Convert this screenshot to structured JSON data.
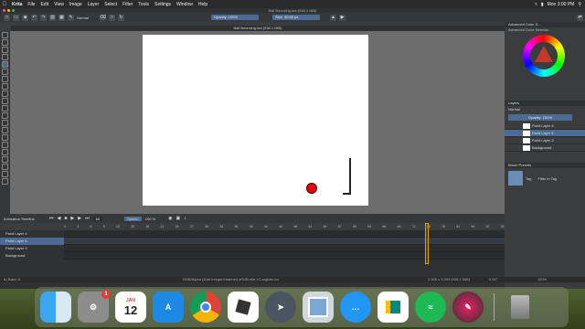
{
  "menubar": {
    "app": "Krita",
    "items": [
      "File",
      "Edit",
      "View",
      "Image",
      "Layer",
      "Select",
      "Filter",
      "Tools",
      "Settings",
      "Window",
      "Help"
    ],
    "clock": "Mon 3:00 PM"
  },
  "window": {
    "title": "Ball Bouncing.kra (938.1 MiB)"
  },
  "toolbar": {
    "blend_mode": "Normal",
    "opacity": "Opacity: 100%",
    "size": "Size: 40.00 px"
  },
  "document_tab": "Ball Bouncing.kra (938.1 MiB)",
  "docker": {
    "color_title": "Advanced Color S...",
    "color_sub": "Advanced Color Selector",
    "layers_title": "Layers",
    "layers_blend": "Normal",
    "layers_opacity": "Opacity: 100%",
    "layers": [
      "Paint Layer 4",
      "Paint Layer 6",
      "Paint Layer 3",
      "Background"
    ],
    "brush_presets_title": "Brush Presets",
    "tag_label": "Tag",
    "filter_label": "Filter in Tag"
  },
  "timeline": {
    "title": "Animation Timeline",
    "frame": "66",
    "speed_label": "Speed:",
    "speed": "100 %",
    "ruler": [
      "0",
      "3",
      "6",
      "9",
      "12",
      "15",
      "18",
      "21",
      "24",
      "27",
      "30",
      "33",
      "36",
      "39",
      "42",
      "45",
      "48",
      "51",
      "54",
      "57",
      "60",
      "63",
      "66",
      "69",
      "72",
      "75",
      "78",
      "81",
      "84",
      "87",
      "90"
    ],
    "layers": [
      "Paint Layer 4",
      "Paint Layer 6",
      "Paint Layer 3",
      "Background"
    ],
    "current_frame": 66
  },
  "statusbar": {
    "tool": "b) Basic-5",
    "color_info": "RGB/Alpha (8-bit integer/channel)  sRGB-elle-V2-srgbtrc.icc",
    "dims": "2,908 x 3,000 (938.1 MiB)",
    "rotation": "0.00°",
    "zoom": "150%"
  },
  "dock": {
    "apps": [
      "Finder",
      "System Preferences",
      "Calendar",
      "App Store",
      "Chrome",
      "Roblox",
      "Rocket",
      "Preview",
      "Messages",
      "Google Meet",
      "Spotify",
      "Krita",
      "Trash"
    ],
    "calendar_month": "JAN",
    "calendar_day": "12",
    "prefs_badge": "1"
  }
}
